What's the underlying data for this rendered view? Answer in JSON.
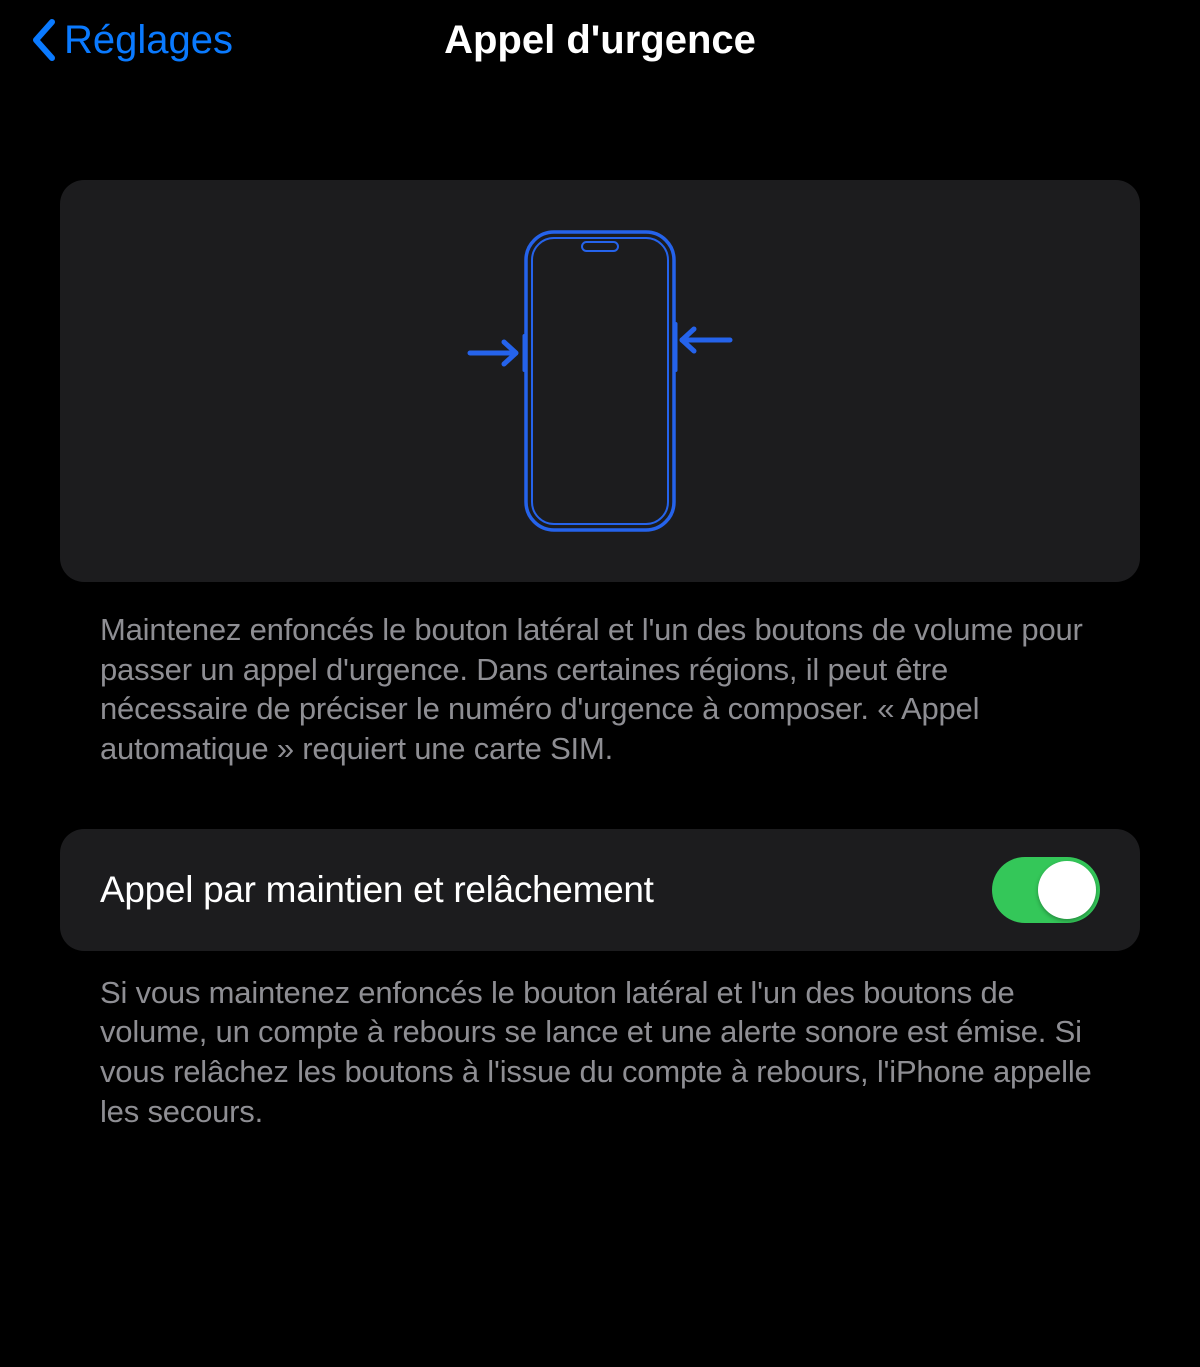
{
  "header": {
    "back_label": "Réglages",
    "title": "Appel d'urgence"
  },
  "illustration": {
    "description": "Maintenez enfoncés le bouton latéral et l'un des boutons de volume pour passer un appel d'urgence. Dans certaines régions, il peut être nécessaire de préciser le numéro d'urgence à composer. « Appel automatique » requiert une carte SIM."
  },
  "settings": {
    "hold_and_release": {
      "label": "Appel par maintien et relâchement",
      "enabled": true,
      "description": "Si vous maintenez enfoncés le bouton latéral et l'un des boutons de volume, un compte à rebours se lance et une alerte sonore est émise. Si vous relâchez les boutons à l'issue du compte à rebours, l'iPhone appelle les secours."
    }
  },
  "colors": {
    "accent_blue": "#0A7AFF",
    "toggle_green": "#34c759",
    "card_bg": "#1c1c1e",
    "secondary_text": "#8e8e93"
  }
}
